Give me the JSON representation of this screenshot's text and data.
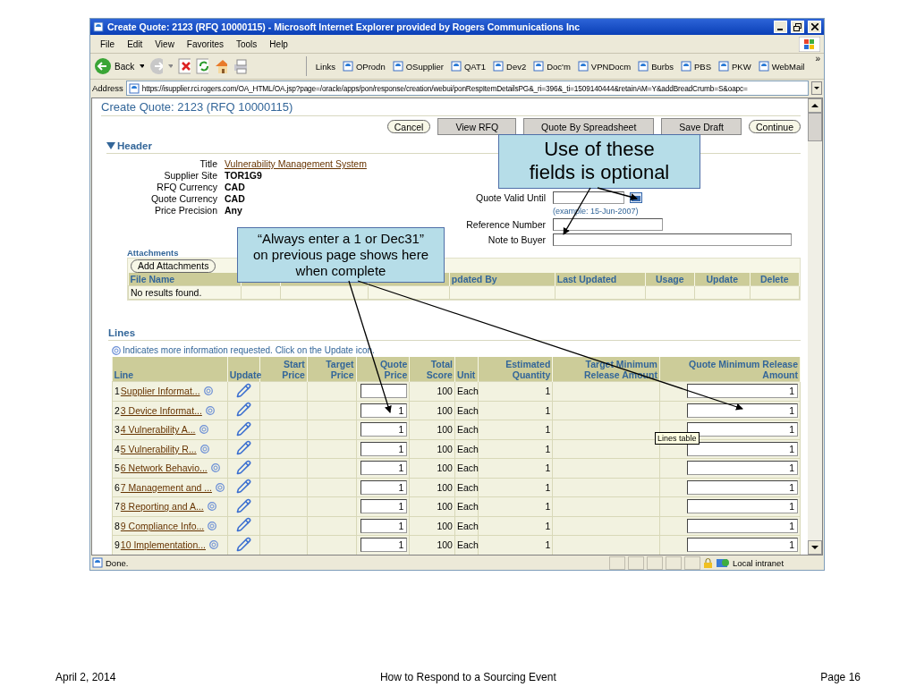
{
  "window": {
    "title": "Create Quote: 2123 (RFQ 10000115) - Microsoft Internet Explorer provided by Rogers Communications Inc"
  },
  "menu": [
    "File",
    "Edit",
    "View",
    "Favorites",
    "Tools",
    "Help"
  ],
  "toolbar": {
    "back": "Back",
    "links_label": "Links",
    "links": [
      "OProdn",
      "OSupplier",
      "QAT1",
      "Dev2",
      "Doc'm",
      "VPNDocm",
      "Burbs",
      "PBS",
      "PKW",
      "WebMail"
    ],
    "more": "»"
  },
  "address": {
    "label": "Address",
    "url": "https://isupplier.rci.rogers.com/OA_HTML/OA.jsp?page=/oracle/apps/pon/response/creation/webui/ponRespItemDetailsPG&_ri=396&_ti=1509140444&retainAM=Y&addBreadCrumb=S&oapc="
  },
  "page": {
    "title": "Create Quote: 2123 (RFQ 10000115)",
    "buttons": [
      {
        "label": "Cancel",
        "kind": "rounded"
      },
      {
        "label": "View RFQ",
        "kind": "square"
      },
      {
        "label": "Quote By Spreadsheet",
        "kind": "square"
      },
      {
        "label": "Save Draft",
        "kind": "square"
      },
      {
        "label": "Continue",
        "kind": "rounded"
      }
    ],
    "header": {
      "title": "Header",
      "expanded": true,
      "fields": [
        {
          "label": "Title",
          "value": "Vulnerability Management System",
          "kind": "link"
        },
        {
          "label": "Supplier Site",
          "value": "TOR1G9",
          "kind": "text"
        },
        {
          "label": "RFQ Currency",
          "value": "CAD",
          "kind": "text"
        },
        {
          "label": "Quote Currency",
          "value": "CAD",
          "kind": "text"
        },
        {
          "label": "Price Precision",
          "value": "Any",
          "kind": "text"
        }
      ],
      "inputs": [
        {
          "label": "Quote Valid Until",
          "kind": "date",
          "hint": "(example: 15-Jun-2007)"
        },
        {
          "label": "Reference Number",
          "kind": "text"
        },
        {
          "label": "Note to Buyer",
          "kind": "wide"
        }
      ]
    },
    "attachments": {
      "title": "Attachments",
      "button": "Add Attachments",
      "columns": [
        "File Name",
        null,
        null,
        null,
        "pdated By",
        "Last Updated",
        "Usage",
        "Update",
        "Delete"
      ],
      "empty": "No results found."
    },
    "lines": {
      "title": "Lines",
      "note": "Indicates more information requested. Click on the Update icon.",
      "columns": [
        "Line",
        "Update",
        "Start Price",
        "Target Price",
        "Quote Price",
        "Total Score",
        "Unit",
        "Estimated Quantity",
        "Target Minimum Release Amount",
        "Quote Minimum Release Amount"
      ],
      "rows": [
        {
          "number": "1",
          "name": "Supplier Informat...",
          "score": "100",
          "unit": "Each",
          "quantity": "1",
          "min_release": "1"
        },
        {
          "number": "2",
          "name": "3 Device Informat...",
          "quote_price": "1",
          "score": "100",
          "unit": "Each",
          "quantity": "1",
          "min_release": "1"
        },
        {
          "number": "3",
          "name": "4 Vulnerability A...",
          "quote_price": "1",
          "score": "100",
          "unit": "Each",
          "quantity": "1",
          "min_release": "1"
        },
        {
          "number": "4",
          "name": "5 Vulnerability R...",
          "quote_price": "1",
          "score": "100",
          "unit": "Each",
          "quantity": "1",
          "min_release": "1"
        },
        {
          "number": "5",
          "name": "6 Network Behavio...",
          "quote_price": "1",
          "score": "100",
          "unit": "Each",
          "quantity": "1",
          "min_release": "1"
        },
        {
          "number": "6",
          "name": "7 Management and ...",
          "quote_price": "1",
          "score": "100",
          "unit": "Each",
          "quantity": "1",
          "min_release": "1"
        },
        {
          "number": "7",
          "name": "8 Reporting and A...",
          "quote_price": "1",
          "score": "100",
          "unit": "Each",
          "quantity": "1",
          "min_release": "1"
        },
        {
          "number": "8",
          "name": "9 Compliance Info...",
          "quote_price": "1",
          "score": "100",
          "unit": "Each",
          "quantity": "1",
          "min_release": "1"
        },
        {
          "number": "9",
          "name": "10 Implementation...",
          "quote_price": "1",
          "score": "100",
          "unit": "Each",
          "quantity": "1",
          "min_release": "1"
        }
      ],
      "tooltip": "Lines table"
    }
  },
  "status_bar": {
    "text": "Done.",
    "zone": "Local intranet"
  },
  "callouts": [
    "Use of these fields is optional",
    "“Always enter a 1 or Dec31” on previous page shows here when complete"
  ],
  "footer": {
    "date": "April 2, 2014",
    "title": "How to Respond to a Sourcing Event",
    "page": "Page 16"
  }
}
